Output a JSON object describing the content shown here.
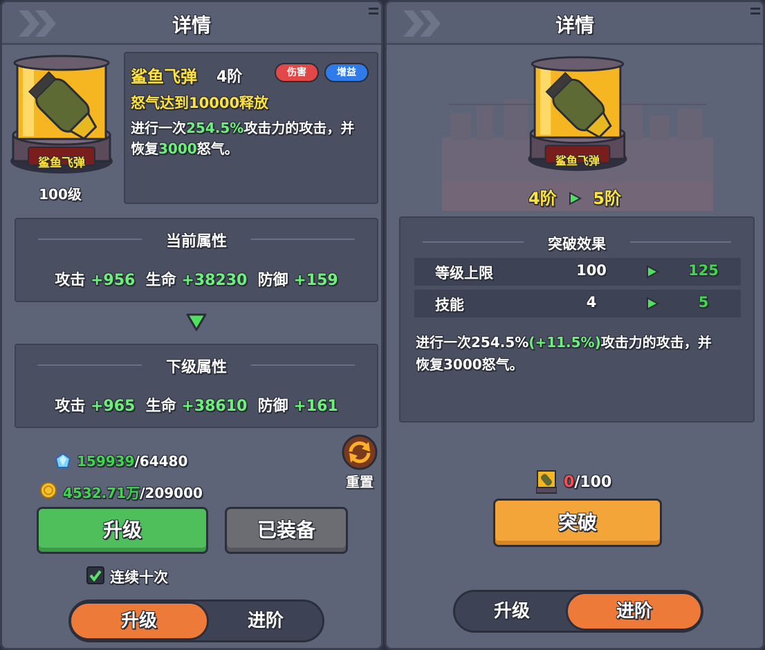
{
  "left": {
    "title": "详情",
    "level": "100级",
    "item_label": "鲨鱼飞弹",
    "name": "鲨鱼飞弹",
    "rank": "4阶",
    "tag_damage": "伤害",
    "tag_buff": "增益",
    "trigger": "怒气达到10000释放",
    "desc_1a": "进行一次",
    "desc_1b": "254.5%",
    "desc_1c": "攻击力的攻击，并",
    "desc_2a": "恢复",
    "desc_2b": "3000",
    "desc_2c": "怒气。",
    "current_title": "当前属性",
    "next_title": "下级属性",
    "current_stats": [
      {
        "label": "攻击",
        "value": "+956"
      },
      {
        "label": "生命",
        "value": "+38230"
      },
      {
        "label": "防御",
        "value": "+159"
      }
    ],
    "next_stats": [
      {
        "label": "攻击",
        "value": "+965"
      },
      {
        "label": "生命",
        "value": "+38610"
      },
      {
        "label": "防御",
        "value": "+161"
      }
    ],
    "gem_have": "159939",
    "gem_need": "/64480",
    "gold_have": "4532.71万",
    "gold_need": "/209000",
    "reset_label": "重置",
    "upgrade_btn": "升级",
    "equipped_btn": "已装备",
    "continuous_label": "连续十次",
    "tab_upgrade": "升级",
    "tab_advance": "进阶"
  },
  "right": {
    "title": "详情",
    "item_label": "鲨鱼飞弹",
    "rank_from": "4阶",
    "rank_to": "5阶",
    "effect_title": "突破效果",
    "rows": [
      {
        "label": "等级上限",
        "from": "100",
        "to": "125"
      },
      {
        "label": "技能",
        "from": "4",
        "to": "5"
      }
    ],
    "desc_1a": "进行一次254.5%",
    "desc_1b": "(+11.5%)",
    "desc_1c": "攻击力的攻击，并",
    "desc_2": "恢复3000怒气。",
    "material_have": "0",
    "material_need": "/100",
    "breakthrough_btn": "突破",
    "tab_upgrade": "升级",
    "tab_advance": "进阶"
  },
  "colors": {
    "panel_bg": "#5e6478",
    "box_bg": "#4a4f62",
    "green_value": "#6cf07a",
    "yellow_title": "#ffe23a",
    "upgrade_green": "#4fbf5c",
    "disabled_gray": "#6b6d72",
    "breakthrough_orange": "#f4a53a",
    "tab_orange": "#ee7a3a",
    "red_count": "#ff4b4b"
  },
  "icons": [
    "chevron-right-icon",
    "menu-icon",
    "shark-missile-icon",
    "gem-icon",
    "gold-coin-icon",
    "reset-icon",
    "checkbox-checked-icon",
    "down-triangle-icon",
    "play-arrow-icon"
  ]
}
